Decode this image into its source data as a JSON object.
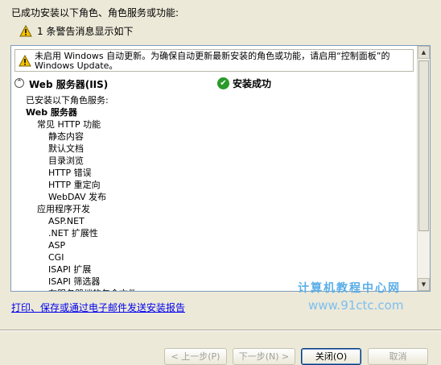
{
  "header": {
    "title": "已成功安装以下角色、角色服务或功能:"
  },
  "warnings": {
    "summary": "1 条警告消息显示如下"
  },
  "panel": {
    "notice": "未启用 Windows 自动更新。为确保自动更新最新安装的角色或功能，请启用“控制面板”的 Windows Update。",
    "role": {
      "collapse_glyph": "⌃",
      "name": "Web 服务器(IIS)",
      "status": "安装成功"
    },
    "details": [
      {
        "text": "已安装以下角色服务:",
        "indent": 0,
        "bold": false
      },
      {
        "text": "Web 服务器",
        "indent": 0,
        "bold": true
      },
      {
        "text": "常见 HTTP 功能",
        "indent": 1,
        "bold": false
      },
      {
        "text": "静态内容",
        "indent": 2,
        "bold": false
      },
      {
        "text": "默认文档",
        "indent": 2,
        "bold": false
      },
      {
        "text": "目录浏览",
        "indent": 2,
        "bold": false
      },
      {
        "text": "HTTP 错误",
        "indent": 2,
        "bold": false
      },
      {
        "text": "HTTP 重定向",
        "indent": 2,
        "bold": false
      },
      {
        "text": "WebDAV 发布",
        "indent": 2,
        "bold": false
      },
      {
        "text": "应用程序开发",
        "indent": 1,
        "bold": false
      },
      {
        "text": "ASP.NET",
        "indent": 2,
        "bold": false
      },
      {
        "text": ".NET 扩展性",
        "indent": 2,
        "bold": false
      },
      {
        "text": "ASP",
        "indent": 2,
        "bold": false
      },
      {
        "text": "CGI",
        "indent": 2,
        "bold": false
      },
      {
        "text": "ISAPI 扩展",
        "indent": 2,
        "bold": false
      },
      {
        "text": "ISAPI 筛选器",
        "indent": 2,
        "bold": false
      },
      {
        "text": "在服务器端的包含文件",
        "indent": 2,
        "bold": false
      }
    ]
  },
  "report_link": "打印、保存或通过电子邮件发送安装报告",
  "watermark": {
    "line1": "计算机教程中心网",
    "line2": "www.91ctc.com"
  },
  "buttons": {
    "prev": "< 上一步(P)",
    "next": "下一步(N) >",
    "close": "关闭(O)",
    "cancel": "取消"
  },
  "icons": {
    "warning": "warning-triangle-icon",
    "success": "success-check-icon",
    "scroll_up": "scroll-up-arrow-icon",
    "scroll_down": "scroll-down-arrow-icon"
  },
  "colors": {
    "background": "#ece9d8",
    "link": "#0000ee",
    "success": "#2a9a2a",
    "warning": "#f5c400"
  }
}
